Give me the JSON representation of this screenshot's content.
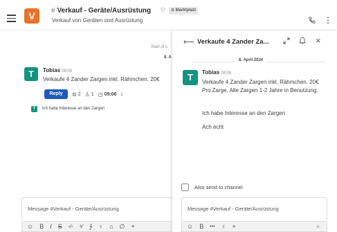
{
  "header": {
    "team_initial": "V",
    "channel_hash": "#",
    "channel_name": "Verkauf - Geräte/Ausrüstung",
    "star": "☆",
    "tag": "⊙ Marktplatz",
    "subtitle": "Verkauf von Geräten und Ausrüstung"
  },
  "main": {
    "start_of": "Start of c",
    "date": "8. Ap",
    "message": {
      "avatar": "T",
      "author": "Tobias",
      "time": "09:05",
      "text": "Verkaufe 4 Zander Zargen inkl. Rähmchen. 20€"
    },
    "reply_label": "Reply",
    "meta": {
      "replies": "2",
      "participants": "1",
      "last_time": "09:06"
    },
    "reply_preview": {
      "avatar": "T",
      "text": "Ich habe Interesse an den Zargen"
    },
    "composer_placeholder": "Message #Verkauf - Geräte/Ausrüstung",
    "toolbar_glyphs": [
      "☺",
      "B",
      "I",
      "S",
      "‹/›",
      "⁴⁄",
      "∱",
      "♀",
      "⌂",
      "∅",
      "+"
    ]
  },
  "thread": {
    "title": "Verkaufe 4 Zander Za...",
    "date": "8. April 2024",
    "message": {
      "avatar": "T",
      "author": "Tobias",
      "time": "09:05",
      "text": "Verkaufe 4 Zander Zargen inkl. Rähmchen. 20€ Pro Zarge. Alle Zargen 1-2 Jahre in Benutzung."
    },
    "replies": [
      "Ich habe Interesse an den Zargen",
      "Ach echt"
    ],
    "also_send_label": "Also send to channel",
    "composer_placeholder": "Message #Verkauf - Geräte/Ausrüstung",
    "toolbar_glyphs": [
      "☺",
      "B",
      "•••",
      "♀",
      "+"
    ],
    "send_glyph": "➤"
  },
  "colors": {
    "accent": "#1e5bb8",
    "team_tile": "#e8722a",
    "avatar": "#15937f"
  }
}
